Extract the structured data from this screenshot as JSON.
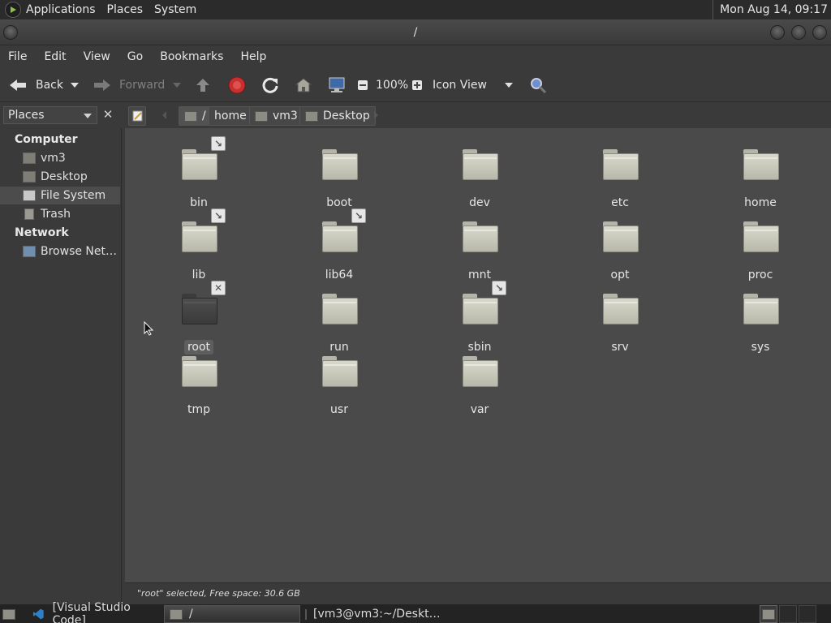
{
  "top_panel": {
    "menus": [
      "Applications",
      "Places",
      "System"
    ],
    "clock": "Mon Aug 14, 09:17"
  },
  "window": {
    "title": "/"
  },
  "menubar": [
    "File",
    "Edit",
    "View",
    "Go",
    "Bookmarks",
    "Help"
  ],
  "toolbar": {
    "back_label": "Back",
    "forward_label": "Forward",
    "zoom": "100%",
    "view_mode": "Icon View"
  },
  "sidebar": {
    "selector": "Places",
    "sections": [
      {
        "heading": "Computer",
        "items": [
          "vm3",
          "Desktop",
          "File System",
          "Trash"
        ]
      },
      {
        "heading": "Network",
        "items": [
          "Browse Net…"
        ]
      }
    ],
    "selected": "File System"
  },
  "pathbar": [
    "/",
    "home",
    "vm3",
    "Desktop"
  ],
  "files": [
    {
      "name": "bin",
      "emblem": "symlink"
    },
    {
      "name": "boot",
      "emblem": ""
    },
    {
      "name": "dev",
      "emblem": ""
    },
    {
      "name": "etc",
      "emblem": ""
    },
    {
      "name": "home",
      "emblem": ""
    },
    {
      "name": "lib",
      "emblem": "symlink"
    },
    {
      "name": "lib64",
      "emblem": "symlink"
    },
    {
      "name": "mnt",
      "emblem": ""
    },
    {
      "name": "opt",
      "emblem": ""
    },
    {
      "name": "proc",
      "emblem": ""
    },
    {
      "name": "root",
      "emblem": "no-access",
      "selected": true
    },
    {
      "name": "run",
      "emblem": ""
    },
    {
      "name": "sbin",
      "emblem": "symlink"
    },
    {
      "name": "srv",
      "emblem": ""
    },
    {
      "name": "sys",
      "emblem": ""
    },
    {
      "name": "tmp",
      "emblem": ""
    },
    {
      "name": "usr",
      "emblem": ""
    },
    {
      "name": "var",
      "emblem": ""
    }
  ],
  "status": "\"root\" selected, Free space: 30.6 GB",
  "taskbar": {
    "tasks": [
      "[Visual Studio Code]",
      "/",
      "[vm3@vm3:~/Deskt…"
    ]
  }
}
